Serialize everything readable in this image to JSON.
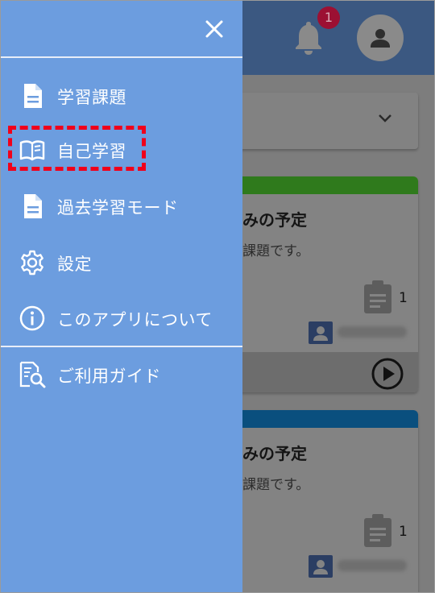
{
  "header": {
    "notification_count": "1"
  },
  "cards": [
    {
      "title": "みの予定",
      "subtitle": "課題です。",
      "count": "1",
      "stripe_color": "#2f8f1a"
    },
    {
      "title": "みの予定",
      "subtitle": "課題です。",
      "count": "1",
      "stripe_color": "#0a5e94"
    }
  ],
  "drawer": {
    "items": [
      {
        "label": "学習課題",
        "icon": "document-icon"
      },
      {
        "label": "自己学習",
        "icon": "open-book-icon"
      },
      {
        "label": "過去学習モード",
        "icon": "document-icon"
      },
      {
        "label": "設定",
        "icon": "gear-icon"
      },
      {
        "label": "このアプリについて",
        "icon": "info-icon"
      },
      {
        "label": "ご利用ガイド",
        "icon": "guide-search-icon"
      }
    ]
  },
  "colors": {
    "drawer_bg": "#6c9ddf",
    "highlight_border": "#f0001b",
    "badge": "#9c1033"
  }
}
